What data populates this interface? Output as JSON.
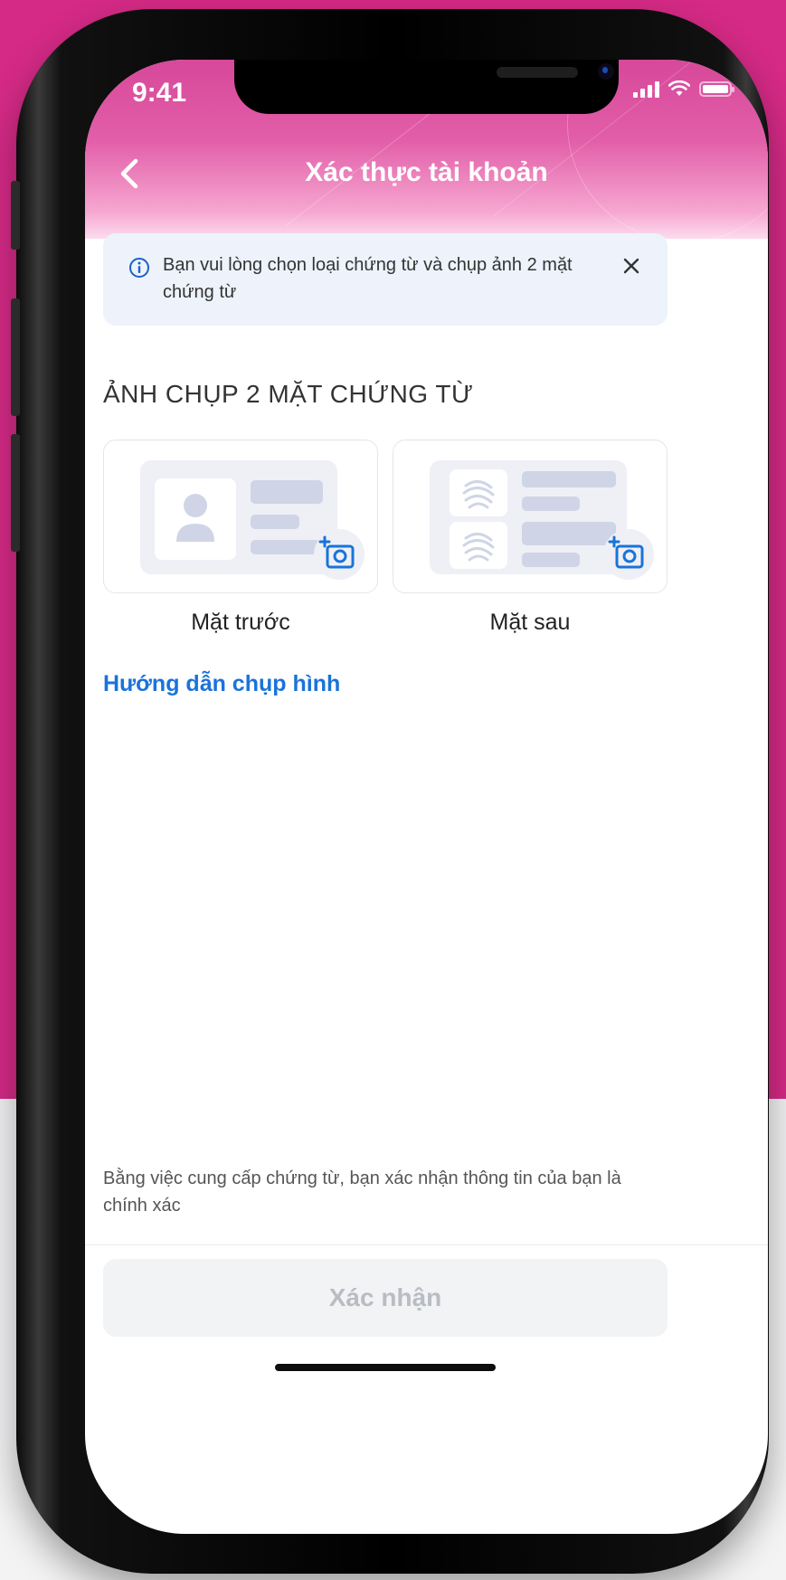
{
  "status_bar": {
    "time": "9:41"
  },
  "header": {
    "title": "Xác thực tài khoản"
  },
  "info_banner": {
    "text": "Bạn vui lòng chọn loại chứng từ và chụp ảnh 2 mặt chứng từ"
  },
  "section": {
    "title": "ẢNH CHỤP 2 MẶT CHỨNG TỪ",
    "cards": [
      {
        "label": "Mặt trước",
        "illustration": "id-card-front"
      },
      {
        "label": "Mặt sau",
        "illustration": "id-card-back-fingerprint"
      }
    ]
  },
  "guide_link": "Hướng dẫn chụp hình",
  "disclaimer": "Bằng việc cung cấp chứng từ, bạn xác nhận thông tin của bạn là chính xác",
  "confirm_button": {
    "label": "Xác nhận",
    "state": "disabled"
  },
  "colors": {
    "brand_pink": "#d52a86",
    "link_blue": "#1a73d9",
    "info_bg": "#edf2fb",
    "disabled_button": "#f2f3f5"
  }
}
